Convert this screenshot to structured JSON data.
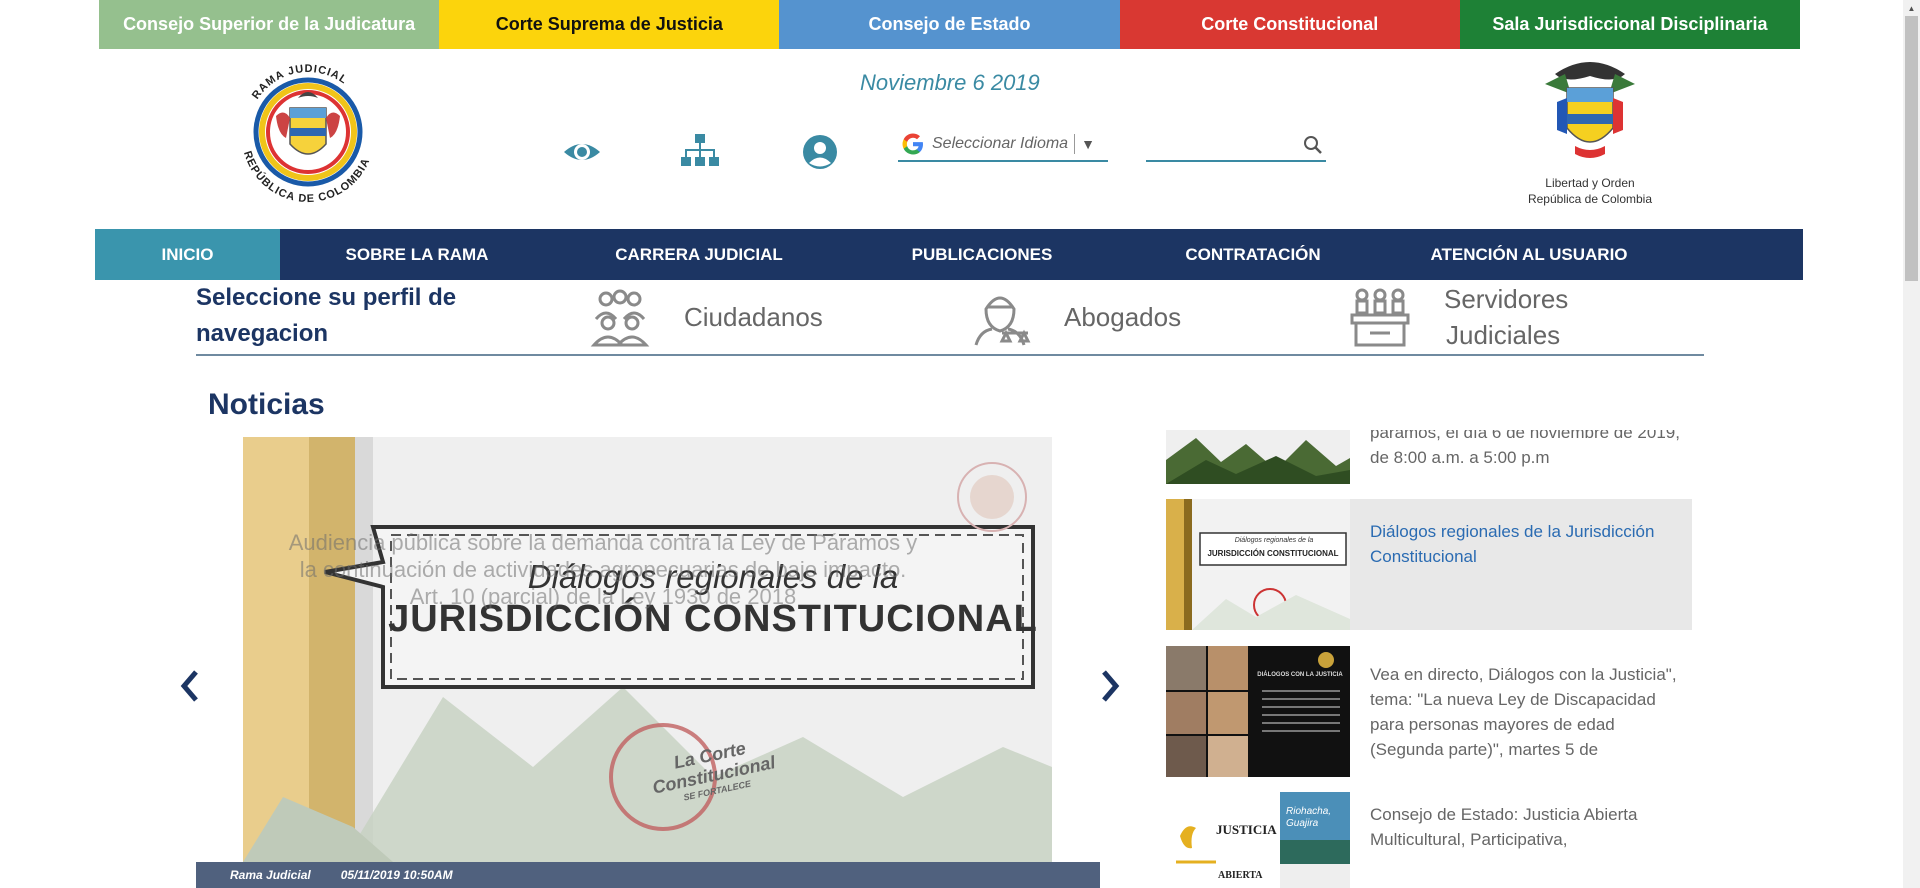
{
  "topbar": [
    {
      "label": "Consejo Superior de la Judicatura",
      "color": "#95c08e"
    },
    {
      "label": "Corte Suprema de Justicia",
      "color": "#fcd40c"
    },
    {
      "label": "Consejo de Estado",
      "color": "#5593cf"
    },
    {
      "label": "Corte Constitucional",
      "color": "#d93832"
    },
    {
      "label": "Sala Jurisdiccional Disciplinaria",
      "color": "#1e8136"
    }
  ],
  "header": {
    "date": "Noviembre 6 2019",
    "logo_left_text": "RAMA JUDICIAL · REPÚBLICA DE COLOMBIA",
    "logo_right_caption_1": "Libertad y Orden",
    "logo_right_caption_2": "República de Colombia",
    "language_placeholder": "Seleccionar Idioma",
    "language_arrow": "▼",
    "search_placeholder": ""
  },
  "nav": [
    {
      "label": "INICIO",
      "active": true
    },
    {
      "label": "SOBRE LA RAMA"
    },
    {
      "label": "CARRERA JUDICIAL"
    },
    {
      "label": "PUBLICACIONES"
    },
    {
      "label": "CONTRATACIÓN"
    },
    {
      "label": "ATENCIÓN AL USUARIO"
    }
  ],
  "profile": {
    "title_line1": "Seleccione su perfil de",
    "title_line2": "navegacion",
    "items": [
      {
        "label": "Ciudadanos",
        "icon": "citizens-icon"
      },
      {
        "label": "Abogados",
        "icon": "lawyer-icon"
      },
      {
        "label": "Servidores",
        "label2": "Judiciales",
        "icon": "servers-icon"
      }
    ]
  },
  "news": {
    "title": "Noticias",
    "slide": {
      "overlay_text": "Audiencia pública sobre la demanda contra la Ley de Páramos y la continuación de actividades agropecuarias de bajo impacto. Art. 10 (parcial) de la Ley 1930 de 2018",
      "banner_line1": "Diálogos regionales de la",
      "banner_line2": "JURISDICCIÓN CONSTITUCIONAL",
      "stamp_line1": "La Corte",
      "stamp_line2": "Constitucional",
      "stamp_line3": "SE FORTALECE",
      "source": "Rama Judicial",
      "datetime": "05/11/2019 10:50AM"
    },
    "list": [
      {
        "text": "páramos, el día 6 de noviembre de 2019, de 8:00 a.m. a 5:00 p.m"
      },
      {
        "text": "Diálogos regionales de la Jurisdicción Constitucional",
        "thumb_line1": "Diálogos regionales de la",
        "thumb_line2": "JURISDICCIÓN CONSTITUCIONAL"
      },
      {
        "text": "Vea en directo, Diálogos con la Justicia\", tema: \"La nueva Ley de Discapacidad para personas mayores de edad (Segunda parte)\", martes 5 de",
        "thumb_title": "DIÁLOGOS CON LA JUSTICIA"
      },
      {
        "text": "Consejo de Estado: Justicia Abierta Multicultural, Participativa,",
        "thumb_line1": "JUSTICIA",
        "thumb_line2": "ABIERTA",
        "thumb_line3": "Riohacha, Guajira"
      }
    ]
  }
}
